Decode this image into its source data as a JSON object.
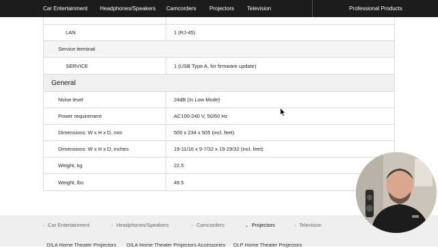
{
  "top_nav": {
    "items": [
      "Car Entertainment",
      "Headphones/Speakers",
      "Camcorders",
      "Projectors",
      "Television"
    ],
    "pro_label": "Professional Products"
  },
  "spec_rows_top": [
    {
      "key": "LAN",
      "value": "1 (RJ-45)",
      "indent": true
    },
    {
      "key": "Service terminal",
      "value": "",
      "indent": false
    },
    {
      "key": "SERVICE",
      "value": "1 (USB Type A, for firmware update)",
      "indent": true
    }
  ],
  "section_title": "General",
  "spec_rows_general": [
    {
      "key": "Noise level",
      "value": "24dB (In Low Mode)"
    },
    {
      "key": "Power requirement",
      "value": "AC100-240 V, 50/60 Hz"
    },
    {
      "key": "Dimensions: W x H x D, mm",
      "value": "500 x 234 x 505 (incl. feet)"
    },
    {
      "key": "Dimensions: W x H x D, inches",
      "value": "19-11/16 x 9-7/32 x 19-29/32 (incl. feet)"
    },
    {
      "key": "Weight, kg",
      "value": "22.5"
    },
    {
      "key": "Weight, lbs",
      "value": "49.5"
    }
  ],
  "bottom_nav": {
    "categories": [
      "Car Entertainment",
      "Headphones/Speakers",
      "Camcorders",
      "Projectors",
      "Television"
    ],
    "active": "Projectors",
    "sub_items": [
      "DILA Home Theater Projectors",
      "DILA Home Theater Projectors Accessories",
      "DLP Home Theater Projectors"
    ]
  }
}
